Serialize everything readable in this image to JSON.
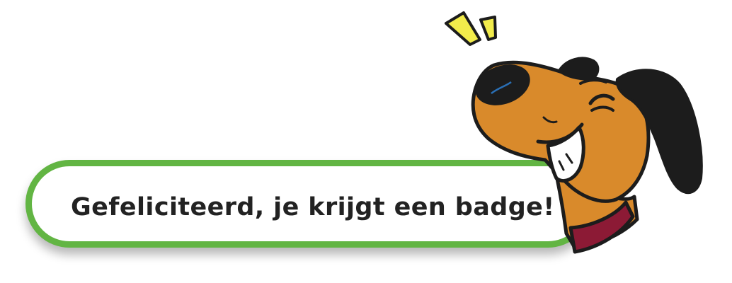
{
  "banner": {
    "message": "Gefeliciteerd, je krijgt een badge!"
  },
  "colors": {
    "banner_border": "#62b543",
    "dog_fur": "#d98a2b",
    "dog_ear": "#1c1c1c",
    "collar": "#8c1a35",
    "sparkle": "#f2ec4b"
  },
  "icons": {
    "mascot": "laughing-dog-icon",
    "sparkles": "sparkle-icon"
  }
}
